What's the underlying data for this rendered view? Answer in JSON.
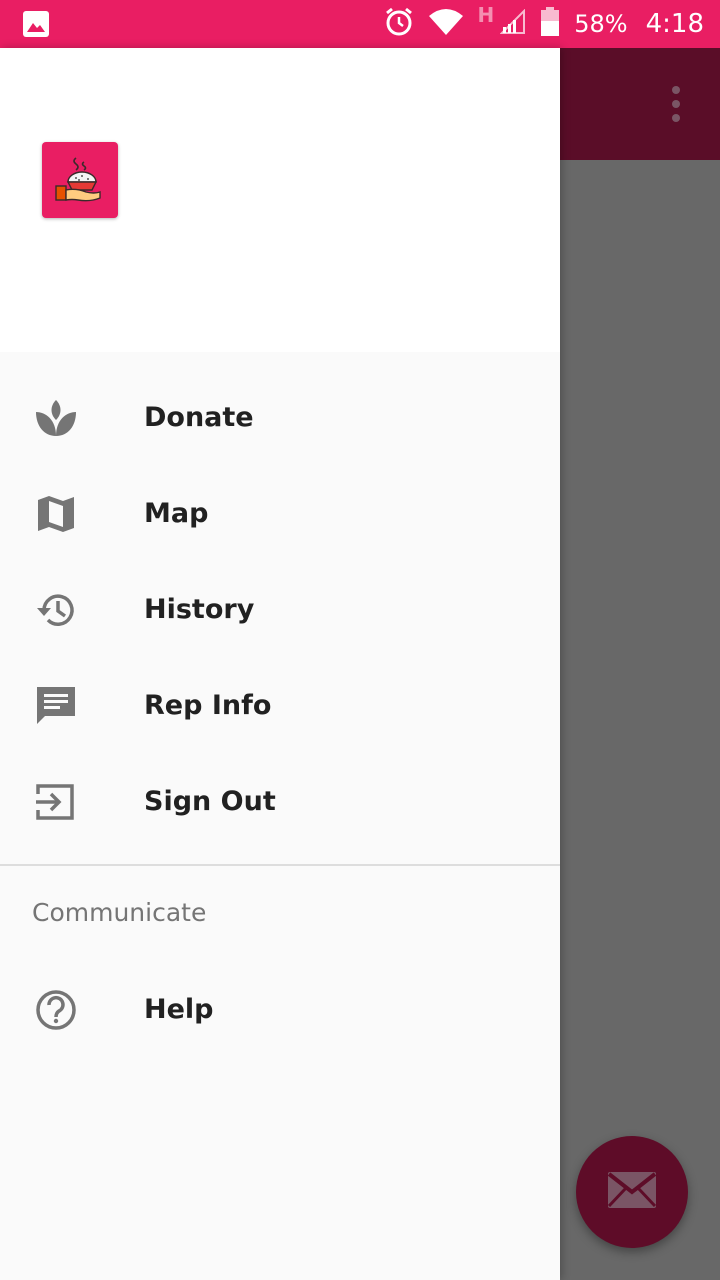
{
  "status_bar": {
    "network_letter": "H",
    "battery": "58%",
    "time": "4:18"
  },
  "drawer": {
    "menu": [
      {
        "label": "Donate",
        "icon": "spa-leaf-icon"
      },
      {
        "label": "Map",
        "icon": "map-icon"
      },
      {
        "label": "History",
        "icon": "history-icon"
      },
      {
        "label": "Rep Info",
        "icon": "message-icon"
      },
      {
        "label": "Sign Out",
        "icon": "exit-icon"
      }
    ],
    "section_title": "Communicate",
    "section_items": [
      {
        "label": "Help",
        "icon": "help-circle-icon"
      }
    ]
  },
  "colors": {
    "status_bar": "#e91e63",
    "toolbar_dimmed": "#5a0d28",
    "fab_dimmed": "#5e0c28",
    "icon_gray": "#757575"
  }
}
